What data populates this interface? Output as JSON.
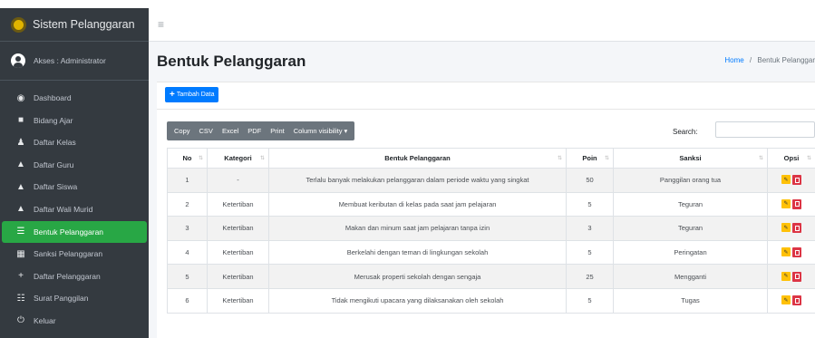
{
  "app": {
    "title": "Sistem Pelanggaran"
  },
  "user": {
    "label": "Akses : Administrator"
  },
  "sidebar": {
    "items": [
      {
        "label": "Dashboard",
        "icon": "dashboard-icon"
      },
      {
        "label": "Bidang Ajar",
        "icon": "book-icon"
      },
      {
        "label": "Daftar Kelas",
        "icon": "users-icon"
      },
      {
        "label": "Daftar Guru",
        "icon": "teacher-icon"
      },
      {
        "label": "Daftar Siswa",
        "icon": "students-icon"
      },
      {
        "label": "Daftar Wali Murid",
        "icon": "parents-icon"
      },
      {
        "label": "Bentuk Pelanggaran",
        "icon": "list-icon",
        "active": true
      },
      {
        "label": "Sanksi Pelanggaran",
        "icon": "table-icon"
      },
      {
        "label": "Daftar Pelanggaran",
        "icon": "plus-icon"
      },
      {
        "label": "Surat Panggilan",
        "icon": "letter-icon"
      },
      {
        "label": "Keluar",
        "icon": "power-icon"
      }
    ]
  },
  "page": {
    "title": "Bentuk Pelanggaran"
  },
  "breadcrumb": {
    "home": "Home",
    "separator": "/",
    "current": "Bentuk Pelanggar"
  },
  "toolbar": {
    "add_label": "Tambah Data"
  },
  "export_buttons": [
    "Copy",
    "CSV",
    "Excel",
    "PDF",
    "Print",
    "Column visibility ▾"
  ],
  "search": {
    "label": "Search:",
    "value": ""
  },
  "table": {
    "columns": [
      "No",
      "Kategori",
      "Bentuk Pelanggaran",
      "Poin",
      "Sanksi",
      "Opsi"
    ],
    "rows": [
      {
        "no": "1",
        "kategori": "-",
        "bentuk": "Terlalu banyak melakukan pelanggaran dalam periode waktu yang singkat",
        "poin": "50",
        "sanksi": "Panggilan orang tua"
      },
      {
        "no": "2",
        "kategori": "Ketertiban",
        "bentuk": "Membuat keributan di kelas pada saat jam pelajaran",
        "poin": "5",
        "sanksi": "Teguran"
      },
      {
        "no": "3",
        "kategori": "Ketertiban",
        "bentuk": "Makan dan minum saat jam pelajaran tanpa izin",
        "poin": "3",
        "sanksi": "Teguran"
      },
      {
        "no": "4",
        "kategori": "Ketertiban",
        "bentuk": "Berkelahi dengan teman di lingkungan sekolah",
        "poin": "5",
        "sanksi": "Peringatan"
      },
      {
        "no": "5",
        "kategori": "Ketertiban",
        "bentuk": "Merusak properti sekolah dengan sengaja",
        "poin": "25",
        "sanksi": "Mengganti"
      },
      {
        "no": "6",
        "kategori": "Ketertiban",
        "bentuk": "Tidak mengikuti upacara yang dilaksanakan oleh sekolah",
        "poin": "5",
        "sanksi": "Tugas"
      }
    ]
  },
  "colors": {
    "sidebar_bg": "#343a40",
    "active_item": "#28a745",
    "primary": "#007bff",
    "edit": "#ffc107",
    "delete": "#dc3545"
  }
}
